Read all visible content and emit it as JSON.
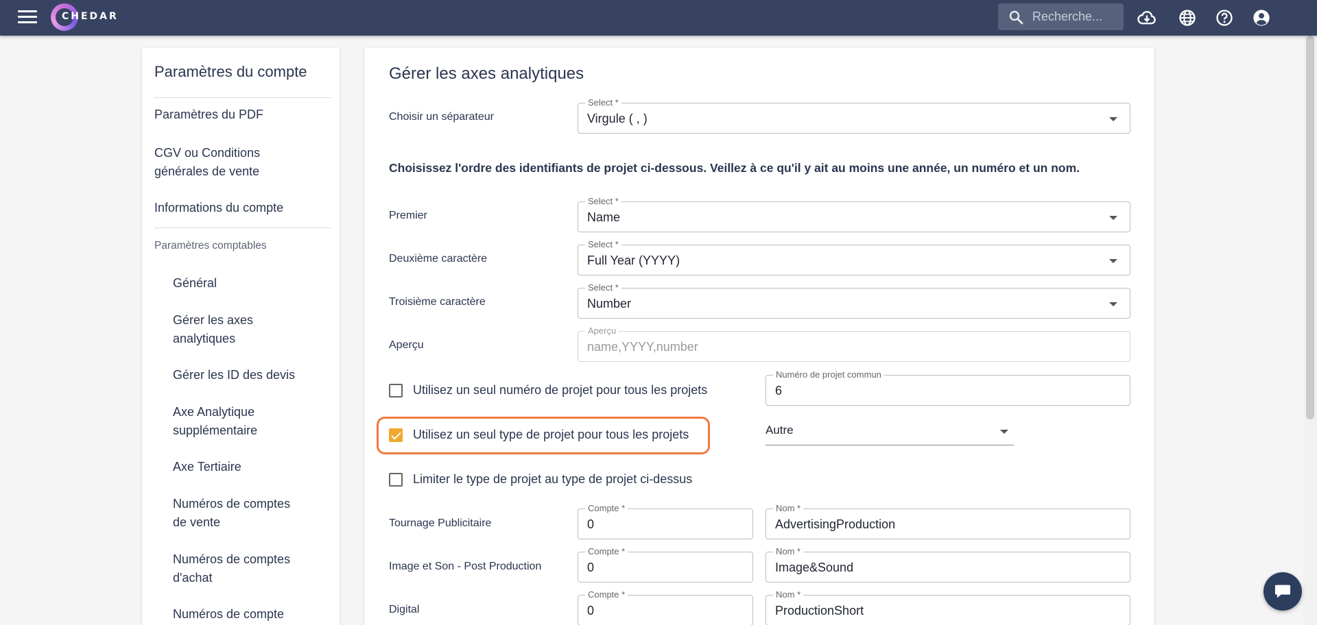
{
  "app": {
    "logo_text": "CHEDAR",
    "search_placeholder": "Recherche..."
  },
  "icons": {
    "menu": "menu-icon",
    "search": "search-icon",
    "download": "cloud-download-icon",
    "language": "globe-icon",
    "help": "help-icon",
    "account": "account-circle-icon",
    "chat": "chat-icon"
  },
  "colors": {
    "topbar": "#374361",
    "accent": "#f0a830",
    "highlight": "#f0793f"
  },
  "sidebar": {
    "title": "Paramètres du compte",
    "items": [
      "Paramètres du PDF",
      "CGV ou Conditions générales de vente",
      "Informations du compte"
    ],
    "section": "Paramètres comptables",
    "subitems": [
      "Général",
      "Gérer les axes analytiques",
      "Gérer les ID des devis",
      "Axe Analytique supplémentaire",
      "Axe Tertiaire",
      "Numéros de comptes de vente",
      "Numéros de comptes d'achat",
      "Numéros de compte"
    ]
  },
  "main": {
    "title": "Gérer les axes analytiques",
    "separator": {
      "label": "Choisir un séparateur",
      "field_label": "Select *",
      "value": "Virgule ( , )"
    },
    "info": "Choisissez l'ordre des identifiants de projet ci-dessous. Veillez à ce qu'il y ait au moins une année, un numéro et un nom.",
    "order": [
      {
        "label": "Premier",
        "field_label": "Select *",
        "value": "Name"
      },
      {
        "label": "Deuxième caractère",
        "field_label": "Select *",
        "value": "Full Year (YYYY)"
      },
      {
        "label": "Troisième caractère",
        "field_label": "Select *",
        "value": "Number"
      }
    ],
    "preview": {
      "label": "Aperçu",
      "field_label": "Aperçu",
      "placeholder": "name,YYYY,number"
    },
    "options": {
      "single_number": {
        "label": "Utilisez un seul numéro de projet pour tous les projets",
        "checked": false,
        "field_label": "Numéro de projet commun",
        "value": "6"
      },
      "single_type": {
        "label": "Utilisez un seul type de projet pour tous les projets",
        "checked": true,
        "select_value": "Autre"
      },
      "limit_type": {
        "label": "Limiter le type de projet au type de projet ci-dessus",
        "checked": false
      }
    },
    "project_types": [
      {
        "label": "Tournage Publicitaire",
        "compte_label": "Compte *",
        "compte": "0",
        "nom_label": "Nom *",
        "nom": "AdvertisingProduction"
      },
      {
        "label": "Image et Son - Post Production",
        "compte_label": "Compte *",
        "compte": "0",
        "nom_label": "Nom *",
        "nom": "Image&Sound"
      },
      {
        "label": "Digital",
        "compte_label": "Compte *",
        "compte": "0",
        "nom_label": "Nom *",
        "nom": "ProductionShort"
      }
    ]
  }
}
